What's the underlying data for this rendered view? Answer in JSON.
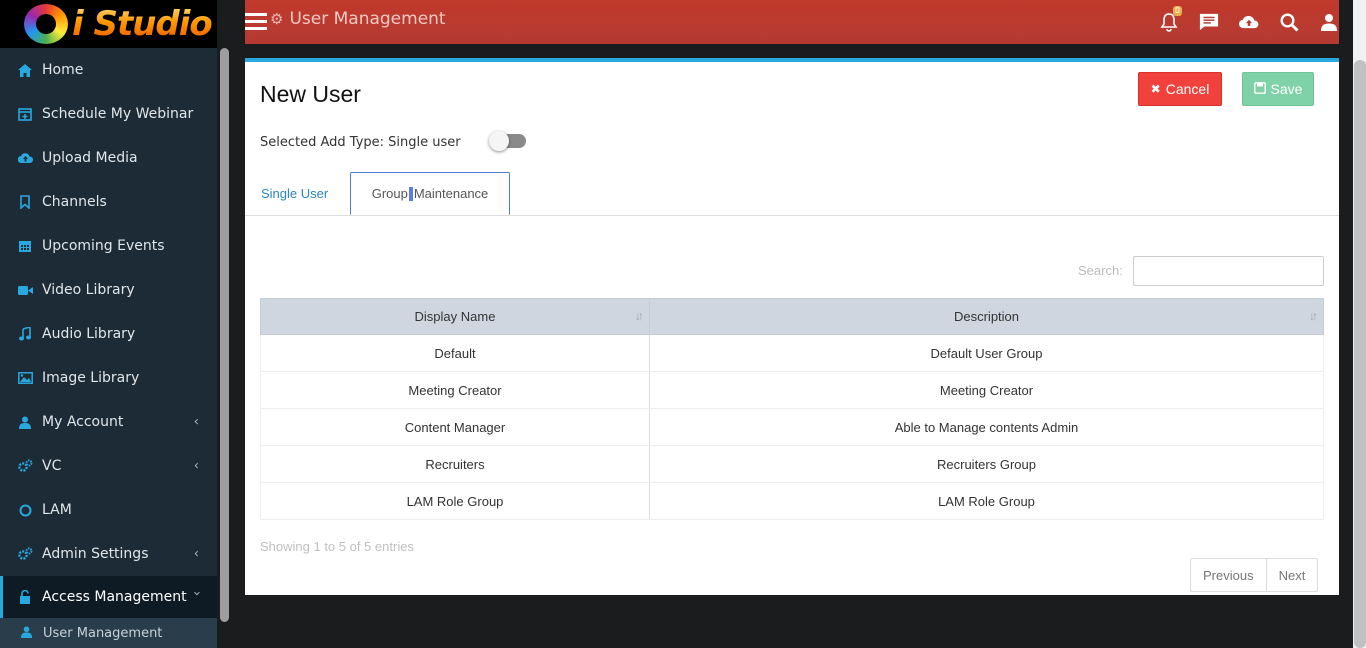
{
  "app": {
    "logo_text": "i Studio"
  },
  "topbar": {
    "title": "User Management",
    "notification_count": "0"
  },
  "sidebar": {
    "items": [
      {
        "label": "Home",
        "icon": "home-icon"
      },
      {
        "label": "Schedule My Webinar",
        "icon": "calendar-plus-icon"
      },
      {
        "label": "Upload Media",
        "icon": "cloud-upload-icon"
      },
      {
        "label": "Channels",
        "icon": "bookmark-icon"
      },
      {
        "label": "Upcoming Events",
        "icon": "calendar-icon"
      },
      {
        "label": "Video Library",
        "icon": "video-camera-icon"
      },
      {
        "label": "Audio Library",
        "icon": "music-note-icon"
      },
      {
        "label": "Image Library",
        "icon": "image-icon"
      },
      {
        "label": "My Account",
        "icon": "user-icon"
      },
      {
        "label": "VC",
        "icon": "gears-icon"
      },
      {
        "label": "LAM",
        "icon": "circle-icon"
      },
      {
        "label": "Admin Settings",
        "icon": "gears-icon"
      },
      {
        "label": "Access Management",
        "icon": "unlock-icon"
      }
    ],
    "sub_items": [
      {
        "label": "User Management",
        "icon": "user-icon"
      }
    ]
  },
  "panel": {
    "heading": "New User",
    "cancel_label": "Cancel",
    "save_label": "Save",
    "add_type_text": "Selected Add Type: Single user",
    "tabs": [
      {
        "label": "Single User"
      },
      {
        "label_part1": "Group",
        "label_part2": "Maintenance"
      }
    ],
    "search_label": "Search:",
    "search_value": ""
  },
  "table": {
    "headers": [
      "Display Name",
      "Description"
    ],
    "rows": [
      [
        "Default",
        "Default User Group"
      ],
      [
        "Meeting Creator",
        "Meeting Creator"
      ],
      [
        "Content Manager",
        "Able to Manage contents Admin"
      ],
      [
        "Recruiters",
        "Recruiters Group"
      ],
      [
        "LAM Role Group",
        "LAM Role Group"
      ]
    ],
    "info": "Showing 1 to 5 of 5 entries",
    "pagination": {
      "previous": "Previous",
      "next": "Next"
    }
  },
  "colors": {
    "topbar": "#b53a32",
    "sidebar": "#1c2b36",
    "accent": "#29a8e0",
    "cancel": "#f0413c",
    "save": "#7fd1a7"
  }
}
